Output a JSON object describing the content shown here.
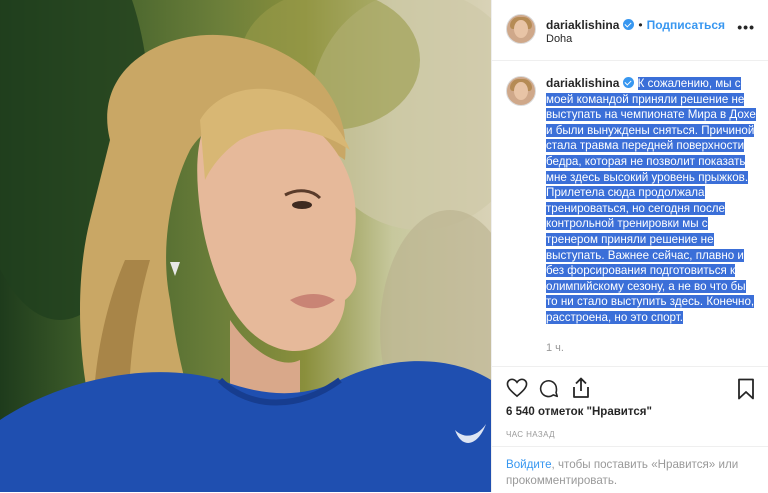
{
  "post": {
    "author": {
      "username": "dariaklishina",
      "follow_label": "Подписаться",
      "separator": "•",
      "location": "Doha",
      "more_label": "•••"
    },
    "caption": {
      "username": "dariaklishina",
      "text": "К сожалению, мы с моей командой приняли решение не выступать на чемпионате Мира в Дохе и были вынуждены сняться. Причиной стала травма передней поверхности бедра, которая не позволит показать мне здесь высокий уровень прыжков. Прилетела сюда продолжала тренироваться, но сегодня после контрольной тренировки мы с тренером приняли решение не выступать. Важнее сейчас, плавно и без форсирования подготовиться к олимпийскому сезону, а не во что бы то ни стало выступить здесь. Конечно, расстроена, но это спорт.",
      "time": "1 ч."
    },
    "likes": "6 540 отметок \"Нравится\"",
    "posted_ago": "ЧАС НАЗАД",
    "comment": {
      "login_link": "Войдите",
      "rest": ", чтобы поставить «Нравится» или прокомментировать."
    },
    "icons": {
      "like": "heart-icon",
      "comment": "comment-bubble-icon",
      "share": "share-icon",
      "save": "bookmark-icon"
    },
    "colors": {
      "link": "#3897f0",
      "highlight": "#3b6fd8",
      "verified": "#3897f0"
    }
  }
}
